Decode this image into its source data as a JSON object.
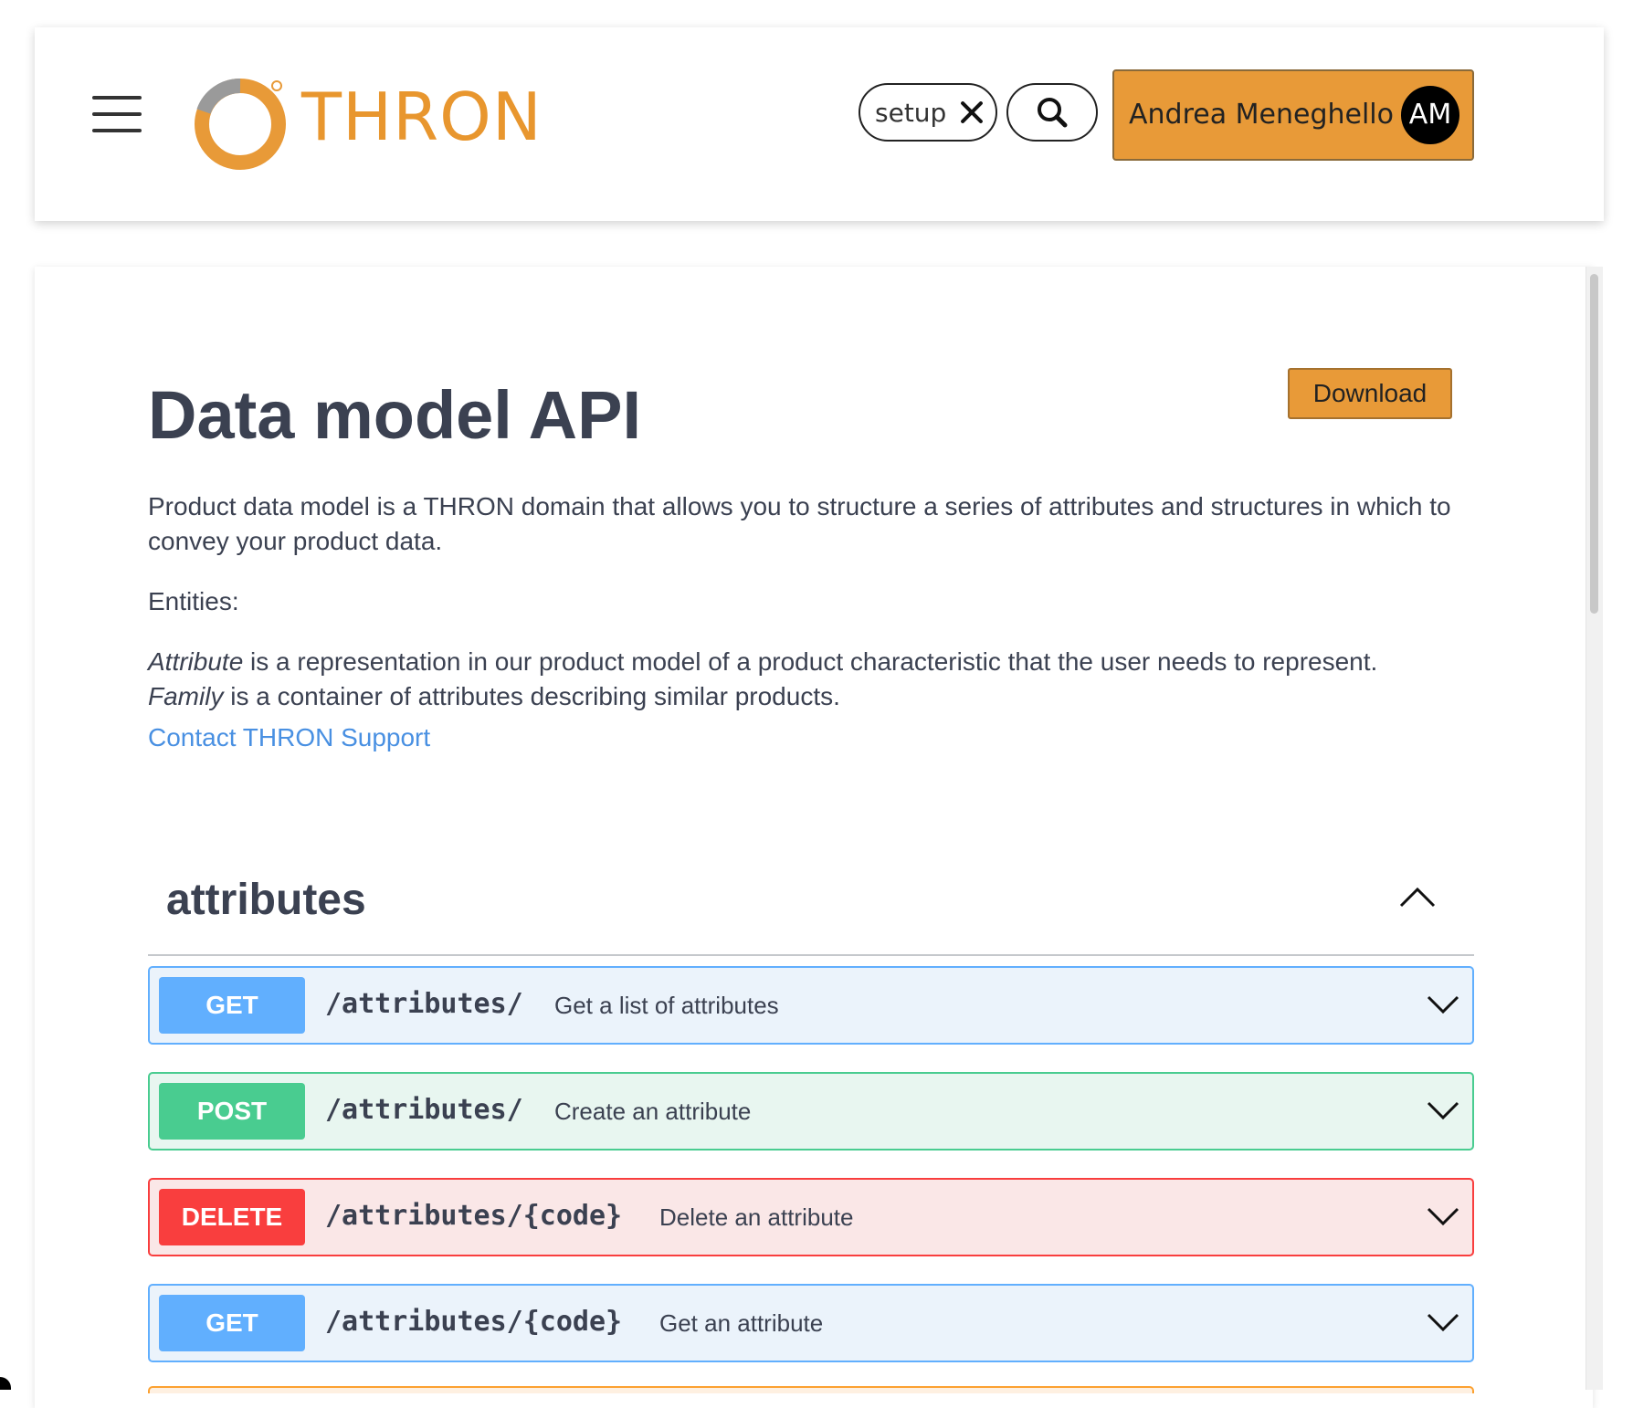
{
  "header": {
    "logo_text": "THRON",
    "search_chip": "setup",
    "user_name": "Andrea Meneghello",
    "user_initials": "AM",
    "brand_color": "#e89a38"
  },
  "api": {
    "title": "Data model API",
    "download_label": "Download",
    "description": "Product data model is a THRON domain that allows you to structure a series of attributes and structures in which to convey your product data.",
    "entities_label": "Entities:",
    "attribute_term": "Attribute",
    "attribute_desc": " is a representation in our product model of a product characteristic that the user needs to represent.",
    "family_term": "Family",
    "family_desc": " is a container of attributes describing similar products.",
    "support_link": "Contact THRON Support"
  },
  "section": {
    "title": "attributes",
    "operations": [
      {
        "method": "GET",
        "path": "/attributes/",
        "summary": "Get a list of attributes",
        "color": "#61affe"
      },
      {
        "method": "POST",
        "path": "/attributes/",
        "summary": "Create an attribute",
        "color": "#49cc90"
      },
      {
        "method": "DELETE",
        "path": "/attributes/{code}",
        "summary": "Delete an attribute",
        "color": "#f93e3e"
      },
      {
        "method": "GET",
        "path": "/attributes/{code}",
        "summary": "Get an attribute",
        "color": "#61affe"
      }
    ]
  }
}
